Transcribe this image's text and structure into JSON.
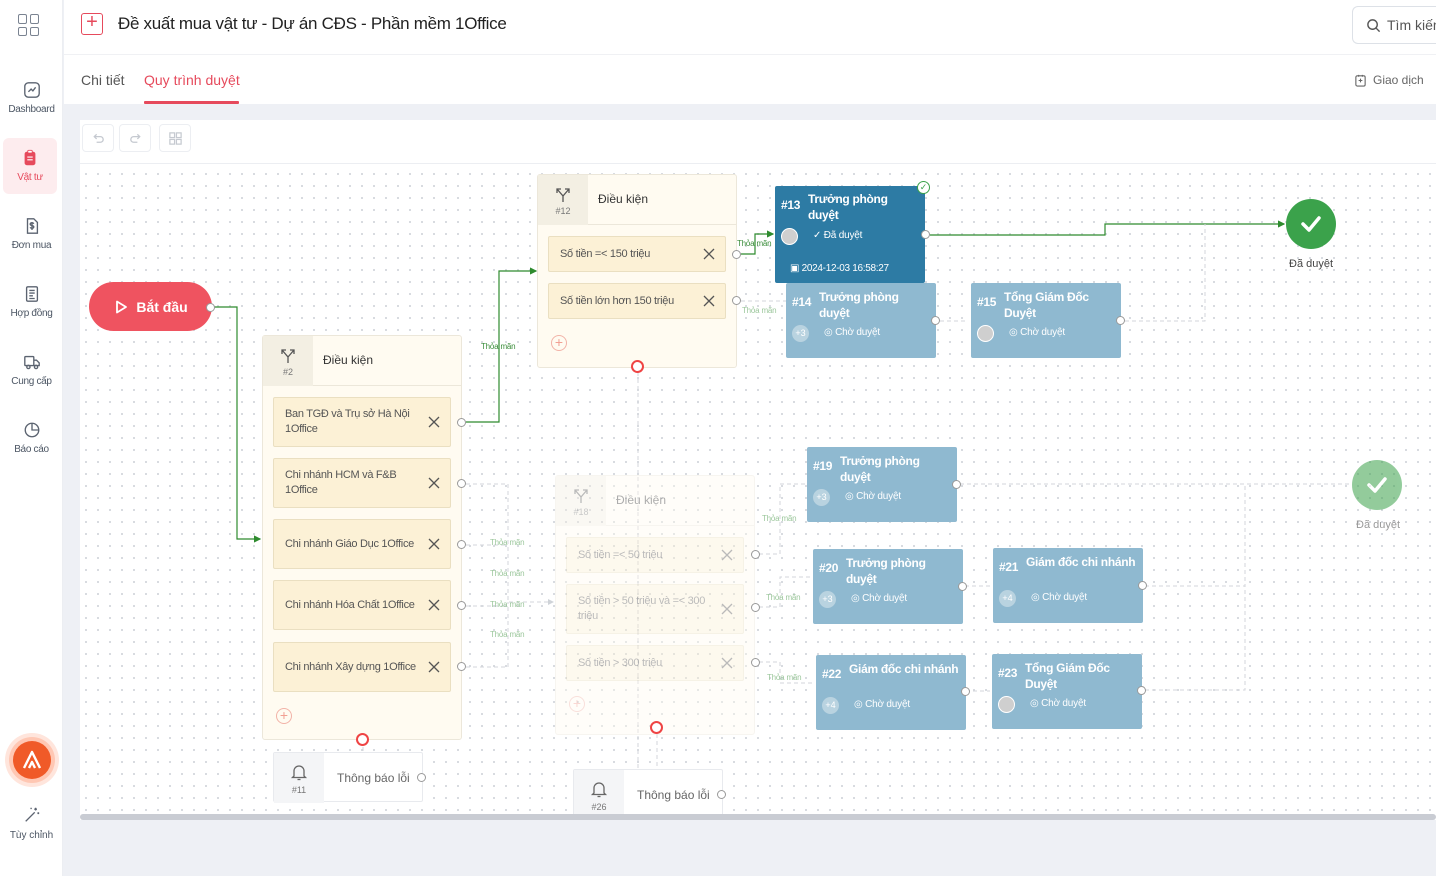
{
  "sidebar": {
    "items": [
      {
        "label": "Dashboard",
        "icon": "dashboard-icon"
      },
      {
        "label": "Vật tư",
        "icon": "clipboard-icon",
        "active": true
      },
      {
        "label": "Đơn mua",
        "icon": "dollar-icon"
      },
      {
        "label": "Hợp đồng",
        "icon": "contract-icon"
      },
      {
        "label": "Cung cấp",
        "icon": "truck-icon"
      },
      {
        "label": "Báo cáo",
        "icon": "pie-chart-icon"
      }
    ],
    "customize_label": "Tùy chỉnh"
  },
  "header": {
    "title": "Đề xuất mua vật tư - Dự án CĐS - Phần mềm 1Office",
    "search_placeholder": "Tìm kiếm",
    "tabs": [
      {
        "label": "Chi tiết",
        "active": false
      },
      {
        "label": "Quy trình duyệt",
        "active": true
      }
    ],
    "transaction_label": "Giao dịch"
  },
  "flow": {
    "start_label": "Bắt đầu",
    "edge_label": "Thỏa mãn",
    "conditions": [
      {
        "id": "#2",
        "title": "Điều kiện",
        "items": [
          "Ban TGĐ và Trụ sở Hà Nội 1Office",
          "Chi nhánh HCM và F&B 1Office",
          "Chi nhánh Giáo Dục 1Office",
          "Chi nhánh Hóa Chất 1Office",
          "Chi nhánh Xây dựng 1Office"
        ]
      },
      {
        "id": "#12",
        "title": "Điều kiện",
        "items": [
          "Số tiền =< 150 triệu",
          "Số tiền lớn hơn 150 triệu"
        ]
      },
      {
        "id": "#18",
        "title": "Điều kiện",
        "items": [
          "Số tiền =< 50 triệu",
          "Số tiền > 50 triệu và =< 300 triệu",
          "Số tiền > 300 triệu"
        ]
      }
    ],
    "nodes": [
      {
        "id": "#13",
        "title": "Trưởng phòng duyệt",
        "status": "Đã duyệt",
        "date": "2024-12-03 16:58:27",
        "avatar": "photo"
      },
      {
        "id": "#14",
        "title": "Trưởng phòng duyệt",
        "status": "Chờ duyệt",
        "avatar": "+3"
      },
      {
        "id": "#15",
        "title": "Tổng Giám Đốc Duyệt",
        "status": "Chờ duyệt",
        "avatar": "photo"
      },
      {
        "id": "#19",
        "title": "Trưởng phòng duyệt",
        "status": "Chờ duyệt",
        "avatar": "+3"
      },
      {
        "id": "#20",
        "title": "Trưởng phòng duyệt",
        "status": "Chờ duyệt",
        "avatar": "+3"
      },
      {
        "id": "#21",
        "title": "Giám đốc chi nhánh",
        "status": "Chờ duyệt",
        "avatar": "+4"
      },
      {
        "id": "#22",
        "title": "Giám đốc chi nhánh",
        "status": "Chờ duyệt",
        "avatar": "+4"
      },
      {
        "id": "#23",
        "title": "Tổng Giám Đốc Duyệt",
        "status": "Chờ duyệt",
        "avatar": "photo"
      }
    ],
    "end_nodes": [
      {
        "label": "Đã duyệt"
      },
      {
        "label": "Đã duyệt"
      }
    ],
    "error_nodes": [
      {
        "id": "#11",
        "title": "Thông báo lỗi"
      },
      {
        "id": "#26",
        "title": "Thông báo lỗi"
      }
    ]
  },
  "colors": {
    "accent": "#e64a5c",
    "node_done": "#2d7ba4",
    "node_pending": "#8fb9d0",
    "end_green": "#3ba24b",
    "edge_green": "#2e8b2e"
  }
}
